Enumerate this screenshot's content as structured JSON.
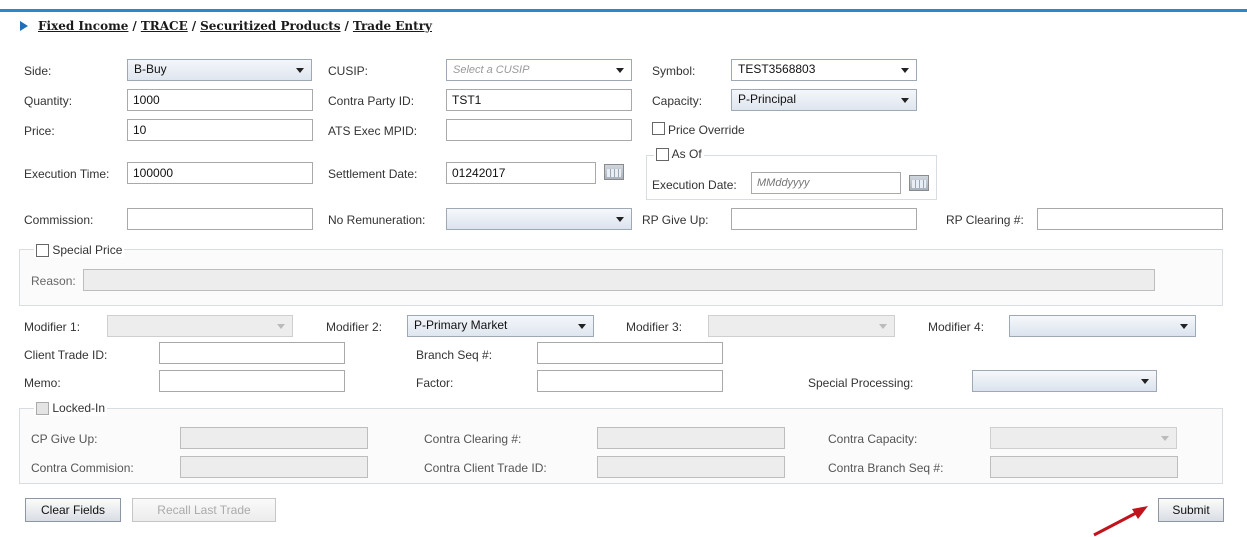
{
  "breadcrumb": [
    "Fixed Income",
    "TRACE",
    "Securitized Products",
    "Trade Entry"
  ],
  "form": {
    "side": {
      "label": "Side:",
      "value": "B-Buy"
    },
    "cusip": {
      "label": "CUSIP:",
      "placeholder": "Select a CUSIP"
    },
    "symbol": {
      "label": "Symbol:",
      "value": "TEST3568803"
    },
    "quantity": {
      "label": "Quantity:",
      "value": "1000"
    },
    "contra_party_id": {
      "label": "Contra Party ID:",
      "value": "TST1"
    },
    "capacity": {
      "label": "Capacity:",
      "value": "P-Principal"
    },
    "price": {
      "label": "Price:",
      "value": "10"
    },
    "ats_exec_mpid": {
      "label": "ATS Exec MPID:",
      "value": ""
    },
    "price_override": {
      "label": "Price Override"
    },
    "execution_time": {
      "label": "Execution Time:",
      "value": "100000"
    },
    "settlement_date": {
      "label": "Settlement Date:",
      "value": "01242017"
    },
    "as_of": {
      "label": "As Of",
      "execution_date_label": "Execution Date:",
      "execution_date_placeholder": "MMddyyyy"
    },
    "commission": {
      "label": "Commission:",
      "value": ""
    },
    "no_remuneration": {
      "label": "No Remuneration:",
      "value": ""
    },
    "rp_give_up": {
      "label": "RP Give Up:",
      "value": ""
    },
    "rp_clearing": {
      "label": "RP Clearing #:",
      "value": ""
    },
    "special_price": {
      "label": "Special Price",
      "reason_label": "Reason:"
    },
    "modifier1": {
      "label": "Modifier 1:",
      "value": ""
    },
    "modifier2": {
      "label": "Modifier 2:",
      "value": "P-Primary Market"
    },
    "modifier3": {
      "label": "Modifier 3:",
      "value": ""
    },
    "modifier4": {
      "label": "Modifier 4:",
      "value": ""
    },
    "client_trade_id": {
      "label": "Client Trade ID:",
      "value": ""
    },
    "branch_seq": {
      "label": "Branch Seq #:",
      "value": ""
    },
    "memo": {
      "label": "Memo:",
      "value": ""
    },
    "factor": {
      "label": "Factor:",
      "value": ""
    },
    "special_processing": {
      "label": "Special Processing:",
      "value": ""
    },
    "locked_in": {
      "label": "Locked-In",
      "cp_give_up": "CP Give Up:",
      "contra_clearing": "Contra Clearing #:",
      "contra_capacity": "Contra Capacity:",
      "contra_commission": "Contra Commision:",
      "contra_client_trade_id": "Contra Client Trade ID:",
      "contra_branch_seq": "Contra Branch Seq #:"
    }
  },
  "buttons": {
    "clear": "Clear Fields",
    "recall": "Recall Last Trade",
    "submit": "Submit"
  },
  "colors": {
    "accent": "#2a87c8",
    "arrow": "#c0141c"
  }
}
